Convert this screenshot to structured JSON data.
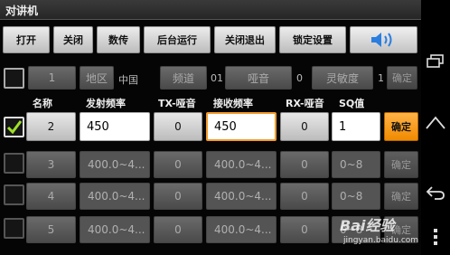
{
  "title": "对讲机",
  "toolbar": {
    "open": "打开",
    "close": "关闭",
    "count": "数传",
    "background": "后台运行",
    "exit": "关闭退出",
    "lock": "锁定设置"
  },
  "channel_row": {
    "num": "1",
    "region_btn": "地区",
    "region_val": "中国",
    "channel_btn": "频道",
    "channel_val": "01",
    "squelch_btn": "哑音",
    "squelch_val": "0",
    "sens_btn": "灵敏度",
    "sens_val": "1",
    "confirm": "确定"
  },
  "headers": {
    "name": "名称",
    "tx_freq": "发射频率",
    "tx_mute": "TX-哑音",
    "rx_freq": "接收频率",
    "rx_mute": "RX-哑音",
    "sq": "SQ值"
  },
  "active_row": {
    "name": "2",
    "tx_freq": "450",
    "tx_mute": "0",
    "rx_freq": "450",
    "rx_mute": "0",
    "sq": "1",
    "confirm": "确定"
  },
  "rows": [
    {
      "name": "3",
      "tx_freq": "400.0~4...",
      "tx_mute": "0",
      "rx_freq": "400.0~4...",
      "rx_mute": "0",
      "sq": "0~8",
      "confirm": "确定"
    },
    {
      "name": "4",
      "tx_freq": "400.0~4...",
      "tx_mute": "0",
      "rx_freq": "400.0~4...",
      "rx_mute": "0",
      "sq": "0~8",
      "confirm": "确定"
    },
    {
      "name": "5",
      "tx_freq": "400.0~4...",
      "tx_mute": "0",
      "rx_freq": "400.0~4...",
      "rx_mute": "0",
      "sq": "0~8",
      "confirm": "确定"
    }
  ],
  "watermark": {
    "logo": "Bai经验",
    "url": "jingyan.baidu.com"
  },
  "icons": {
    "speaker": "speaker-icon",
    "check": "check-icon",
    "recent": "recent-apps-icon",
    "home": "home-icon",
    "back": "back-icon",
    "menu": "menu-icon"
  },
  "colors": {
    "accent": "#f39b2c",
    "check": "#9fe02a",
    "speaker": "#2a7ee0"
  }
}
